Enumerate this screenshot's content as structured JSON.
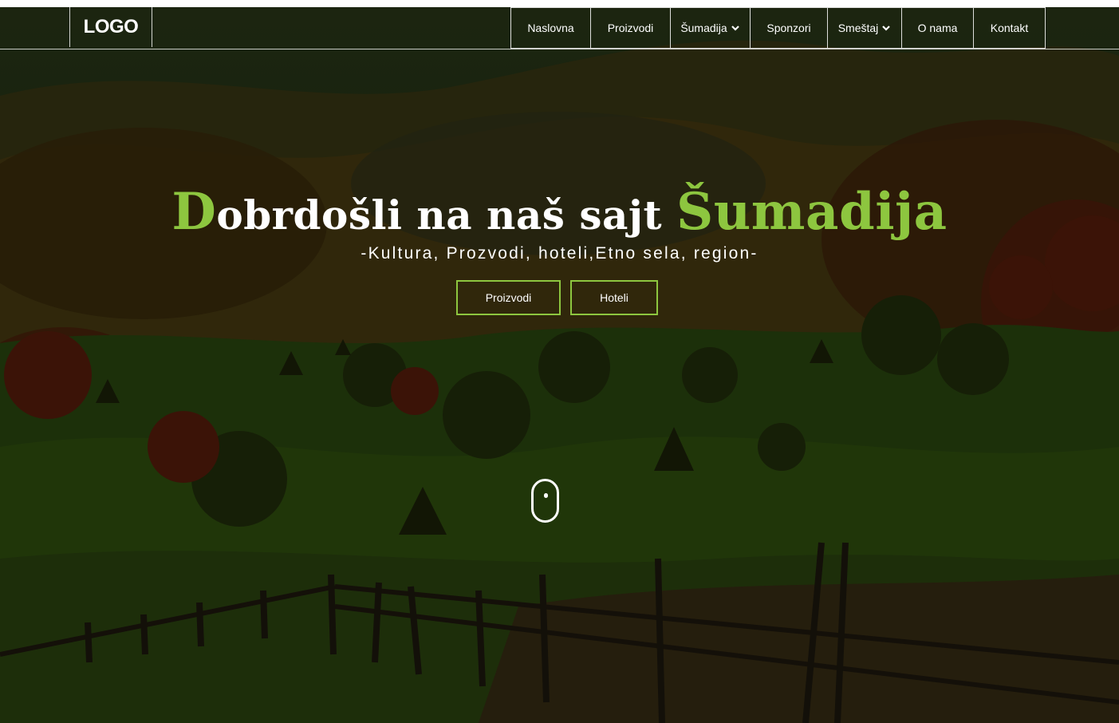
{
  "header": {
    "logo": "LOGO",
    "nav": [
      {
        "label": "Naslovna",
        "dropdown": false
      },
      {
        "label": "Proizvodi",
        "dropdown": false
      },
      {
        "label": "Šumadija",
        "dropdown": true
      },
      {
        "label": "Sponzori",
        "dropdown": false
      },
      {
        "label": "Smeštaj",
        "dropdown": true
      },
      {
        "label": "O nama",
        "dropdown": false
      },
      {
        "label": "Kontakt",
        "dropdown": false
      }
    ]
  },
  "hero": {
    "title_first_letter": "D",
    "title_rest": "obrdošli na naš sajt ",
    "title_accent": "Šumadija",
    "subtitle": "-Kultura, Prozvodi, hoteli,Etno sela, region-",
    "buttons": {
      "products": "Proizvodi",
      "hotels": "Hoteli"
    }
  },
  "colors": {
    "accent": "#8dc63f",
    "text": "#ffffff"
  },
  "icons": {
    "scroll": "mouse-scroll-icon",
    "dropdown": "chevron-down-icon"
  }
}
